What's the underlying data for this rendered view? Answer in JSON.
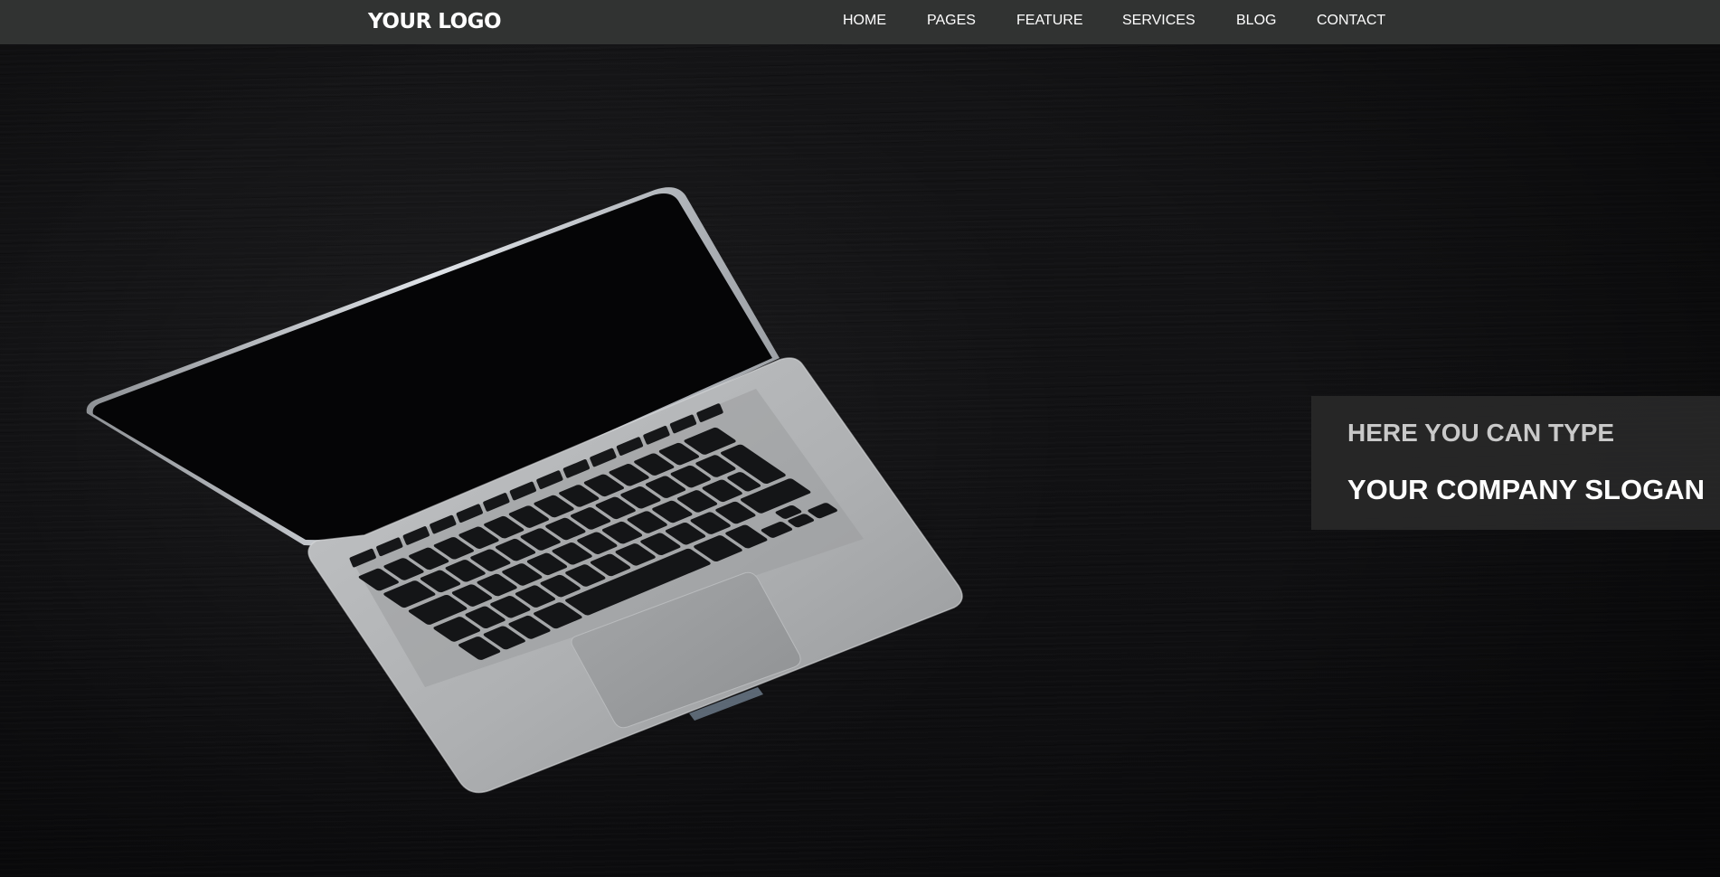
{
  "header": {
    "logo": "YOUR LOGO",
    "background_color": "#313332",
    "nav": [
      {
        "label": "HOME"
      },
      {
        "label": "PAGES"
      },
      {
        "label": "FEATURE"
      },
      {
        "label": "SERVICES"
      },
      {
        "label": "BLOG"
      },
      {
        "label": "CONTACT"
      }
    ]
  },
  "hero": {
    "background_color": "#111113",
    "image": "laptop-photo",
    "slogan": {
      "line1": "HERE YOU CAN TYPE",
      "line2": "YOUR COMPANY SLOGAN",
      "box_color": "#282828"
    }
  }
}
